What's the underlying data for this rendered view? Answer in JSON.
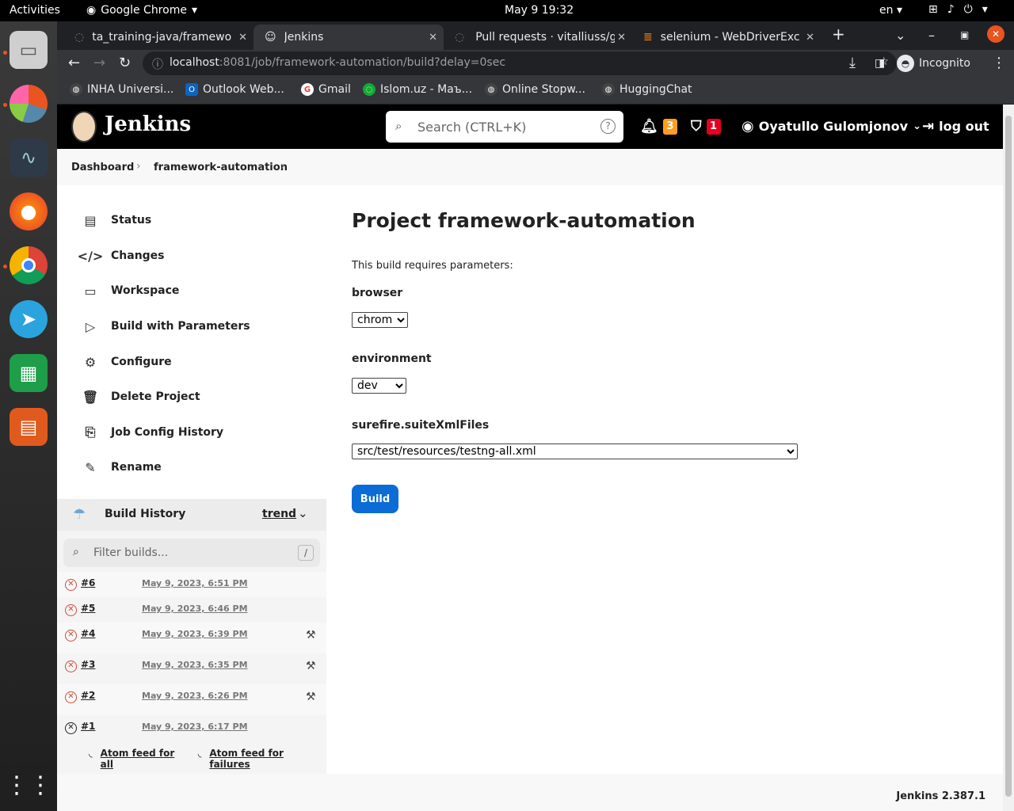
{
  "desktop": {
    "activities": "Activities",
    "app_name": "Google Chrome",
    "clock": "May 9  19:32",
    "lang": "en"
  },
  "tabs": [
    {
      "label": "ta_training-java/framewo"
    },
    {
      "label": "Jenkins"
    },
    {
      "label": "Pull requests · vitalliuss/g"
    },
    {
      "label": "selenium - WebDriverExce"
    }
  ],
  "address": {
    "host": "localhost",
    "path": ":8081/job/framework-automation/build?delay=0sec",
    "profile": "Incognito"
  },
  "bookmarks": [
    {
      "label": "INHA Universi..."
    },
    {
      "label": "Outlook Web..."
    },
    {
      "label": "Gmail"
    },
    {
      "label": "Islom.uz - Маъ..."
    },
    {
      "label": "Online Stopw..."
    },
    {
      "label": "HuggingChat"
    }
  ],
  "jenkins": {
    "title": "Jenkins",
    "search_placeholder": "Search (CTRL+K)",
    "help": "?",
    "notifications": "3",
    "security": "1",
    "user": "Oyatullo Gulomjonov",
    "logout": "log out",
    "version": "Jenkins 2.387.1"
  },
  "breadcrumb": [
    "Dashboard",
    "framework-automation"
  ],
  "sidebar": [
    {
      "label": "Status"
    },
    {
      "label": "Changes"
    },
    {
      "label": "Workspace"
    },
    {
      "label": "Build with Parameters"
    },
    {
      "label": "Configure"
    },
    {
      "label": "Delete Project"
    },
    {
      "label": "Job Config History"
    },
    {
      "label": "Rename"
    }
  ],
  "build_history": {
    "title": "Build History",
    "trend": "trend",
    "filter_placeholder": "Filter builds...",
    "filter_shortcut": "/",
    "builds": [
      {
        "num": "#6",
        "date": "May 9, 2023, 6:51 PM",
        "status": "failed"
      },
      {
        "num": "#5",
        "date": "May 9, 2023, 6:46 PM",
        "status": "failed"
      },
      {
        "num": "#4",
        "date": "May 9, 2023, 6:39 PM",
        "status": "failed"
      },
      {
        "num": "#3",
        "date": "May 9, 2023, 6:35 PM",
        "status": "failed"
      },
      {
        "num": "#2",
        "date": "May 9, 2023, 6:26 PM",
        "status": "failed"
      },
      {
        "num": "#1",
        "date": "May 9, 2023, 6:17 PM",
        "status": "aborted"
      }
    ],
    "feed_all": "Atom feed for all",
    "feed_failures": "Atom feed for failures"
  },
  "main": {
    "title": "Project framework-automation",
    "description": "This build requires parameters:",
    "params": [
      {
        "name": "browser",
        "value": "chrome"
      },
      {
        "name": "environment",
        "value": "dev"
      },
      {
        "name": "surefire.suiteXmlFiles",
        "value": "src/test/resources/testng-all.xml"
      }
    ],
    "build_button": "Build"
  }
}
